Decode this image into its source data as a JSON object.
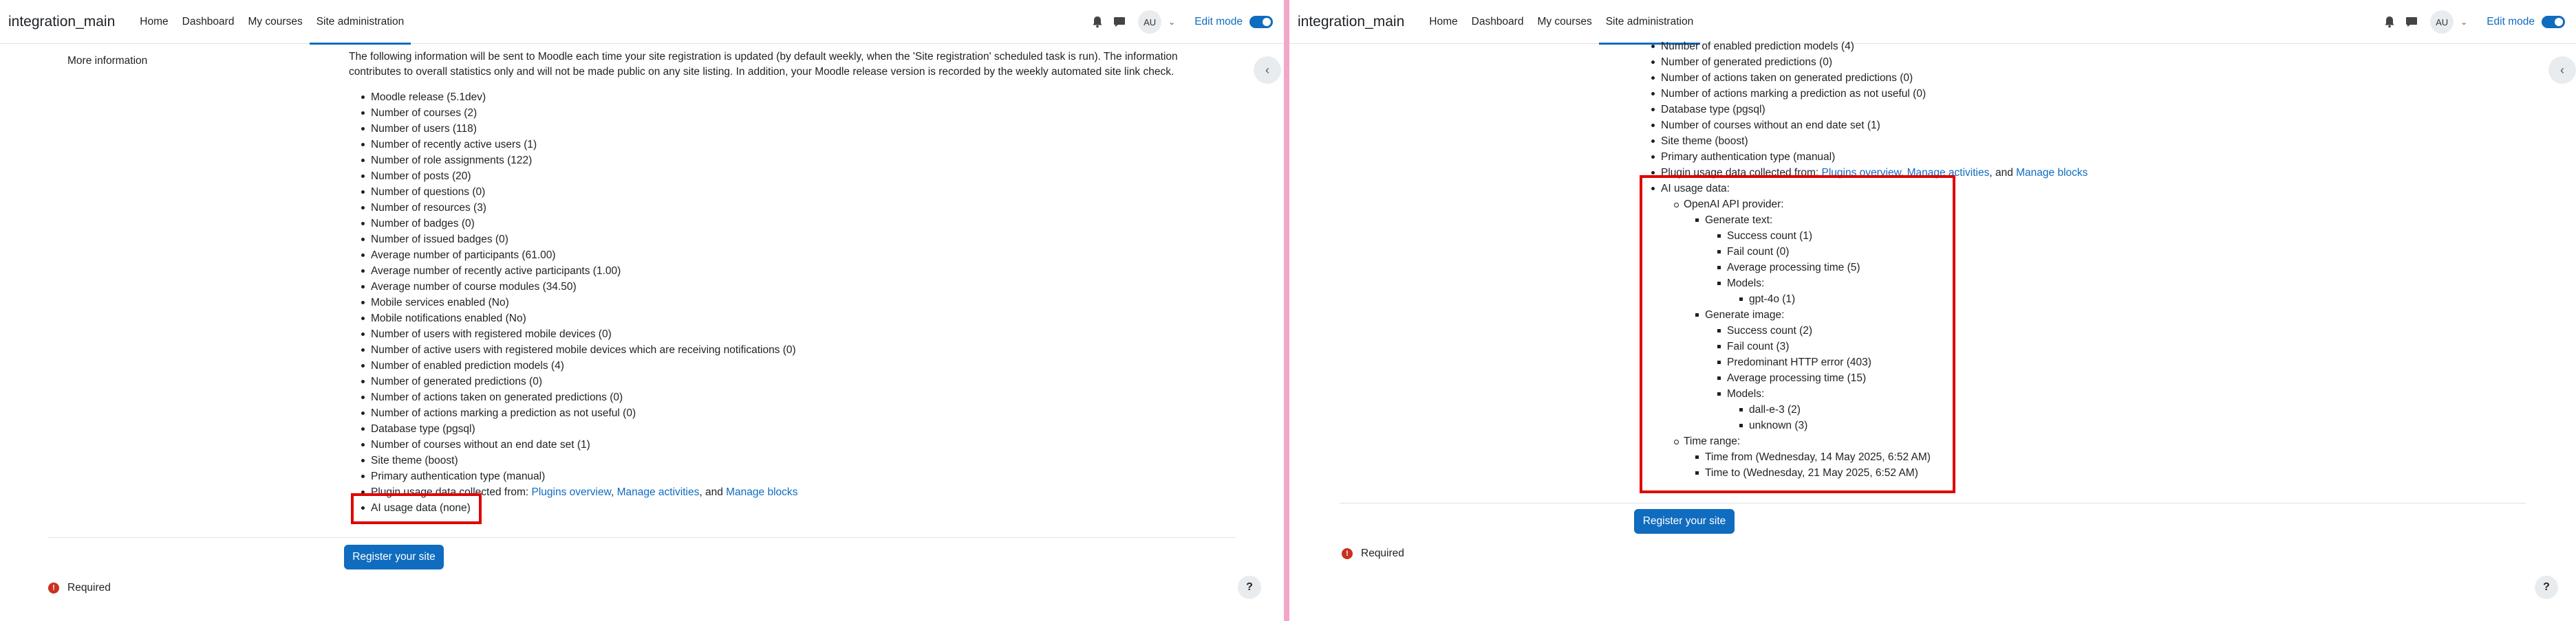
{
  "nav": {
    "brand": "integration_main",
    "links": [
      "Home",
      "Dashboard",
      "My courses",
      "Site administration"
    ],
    "avatar": "AU",
    "edit_mode": "Edit mode"
  },
  "left": {
    "section_label": "More information",
    "intro": "The following information will be sent to Moodle each time your site registration is updated (by default weekly, when the 'Site registration' scheduled task is run). The information contributes to overall statistics only and will not be made public on any site listing. In addition, your Moodle release version is recorded by the weekly automated site link check.",
    "items": [
      "Moodle release (5.1dev)",
      "Number of courses (2)",
      "Number of users (118)",
      "Number of recently active users (1)",
      "Number of role assignments (122)",
      "Number of posts (20)",
      "Number of questions (0)",
      "Number of resources (3)",
      "Number of badges (0)",
      "Number of issued badges (0)",
      "Average number of participants (61.00)",
      "Average number of recently active participants (1.00)",
      "Average number of course modules (34.50)",
      "Mobile services enabled (No)",
      "Mobile notifications enabled (No)",
      "Number of users with registered mobile devices (0)",
      "Number of active users with registered mobile devices which are receiving notifications (0)",
      "Number of enabled prediction models (4)",
      "Number of generated predictions (0)",
      "Number of actions taken on generated predictions (0)",
      "Number of actions marking a prediction as not useful (0)",
      "Database type (pgsql)",
      "Number of courses without an end date set (1)",
      "Site theme (boost)",
      "Primary authentication type (manual)"
    ],
    "plugin_prefix": "Plugin usage data collected from: ",
    "plugin_link1": "Plugins overview",
    "plugin_sep1": ", ",
    "plugin_link2": "Manage activities",
    "plugin_sep2": ", and ",
    "plugin_link3": "Manage blocks",
    "ai_usage": "AI usage data (none)",
    "register_button": "Register your site",
    "required": "Required"
  },
  "right": {
    "items": [
      "Number of enabled prediction models (4)",
      "Number of generated predictions (0)",
      "Number of actions taken on generated predictions (0)",
      "Number of actions marking a prediction as not useful (0)",
      "Database type (pgsql)",
      "Number of courses without an end date set (1)",
      "Site theme (boost)",
      "Primary authentication type (manual)"
    ],
    "plugin_prefix": "Plugin usage data collected from: ",
    "plugin_link1": "Plugins overview",
    "plugin_sep1": ", ",
    "plugin_link2": "Manage activities",
    "plugin_sep2": ", and ",
    "plugin_link3": "Manage blocks",
    "ai": {
      "title": "AI usage data:",
      "provider": "OpenAI API provider:",
      "gen_text": "Generate text:",
      "gen_text_items": [
        "Success count (1)",
        "Fail count (0)",
        "Average processing time (5)",
        "Models:"
      ],
      "gen_text_models": [
        "gpt-4o (1)"
      ],
      "gen_image": "Generate image:",
      "gen_image_items": [
        "Success count (2)",
        "Fail count (3)",
        "Predominant HTTP error (403)",
        "Average processing time (15)",
        "Models:"
      ],
      "gen_image_models": [
        "dall-e-3 (2)",
        "unknown (3)"
      ],
      "time_range": "Time range:",
      "time_from": "Time from (Wednesday, 14 May 2025, 6:52 AM)",
      "time_to": "Time to (Wednesday, 21 May 2025, 6:52 AM)"
    },
    "register_button": "Register your site",
    "required": "Required"
  }
}
